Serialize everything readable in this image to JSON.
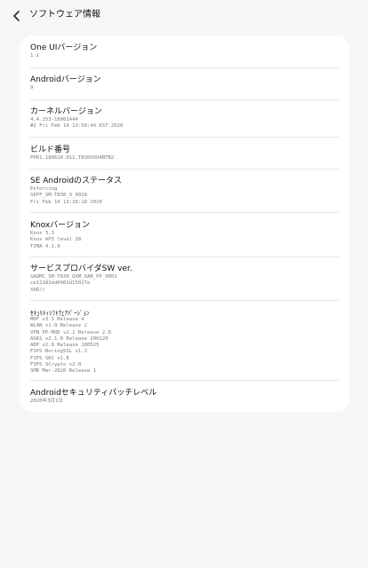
{
  "header": {
    "title": "ソフトウェア情報",
    "back_icon": "chevron-left-icon"
  },
  "items": [
    {
      "title": "One UIバージョン",
      "value": "1.1"
    },
    {
      "title": "Androidバージョン",
      "value": "9"
    },
    {
      "title": "カーネルバージョン",
      "value": "4.4.153-18001444\n#2 Fri Feb 14 13:50:44 KST 2020"
    },
    {
      "title": "ビルド番号",
      "value": "PPR1.180610.011.T830XXU4BTB2"
    },
    {
      "title": "SE Androidのステータス",
      "value": "Enforcing\nSEPF_SM-T830_9_0018\nFri Feb 14 13:28:18 2020"
    },
    {
      "title": "Knoxバージョン",
      "value": "Knox 3.3\nKnox API level 28\nTIMA 4.1.0"
    },
    {
      "title": "サービスプロバイダSW ver.",
      "value": "SAOMC_SM-T830_OXM_XAR_PP_0001\nce12182ed0901d15027e\nXAR//"
    },
    {
      "title": "ｾｷｭﾘﾃｨｿﾌﾄｳｪｱﾊﾞｰｼﾞｮﾝ",
      "value": "MDF v3.1 Release 4\nWLAN v1.0 Release 2\nVPN PP-MOD v2.1 Release 2.0\nASKS v2.1.0 Release 200120\nADP v2.0 Release 180525\nFIPS BoringSSL v1.3\nFIPS SKC v1.8\nFIPS SCrypto v2.0\nSMR Mar-2020 Release 1"
    },
    {
      "title": "Androidセキュリティパッチレベル",
      "value": "2020年3月1日"
    }
  ]
}
